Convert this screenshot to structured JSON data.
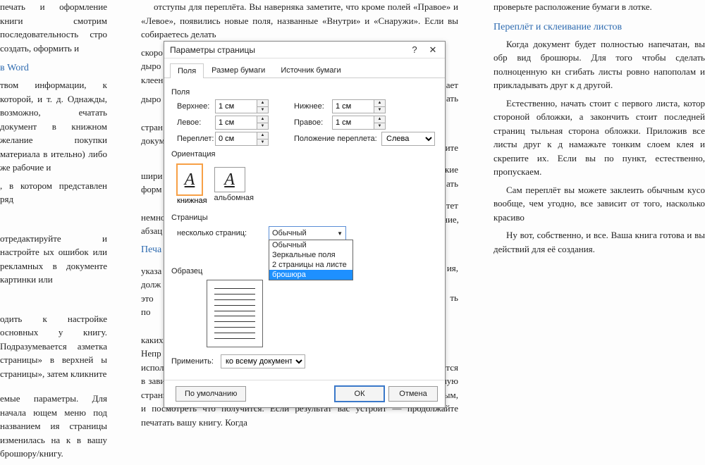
{
  "doc": {
    "left": {
      "p1": "печать и оформление книги смотрим последовательность стро создать, оформить и",
      "h1": "в Word",
      "p2": "твом информации, к которой, и т. д. Однажды, возможно, ечатать документ в книжном желание покупки материала в ительно) либо же рабочие и",
      "p3": ", в котором представлен ряд",
      "p4": "отредактируйте и настройте ых ошибок или рекламных в документе картинки или",
      "p5": "одить к настройке основных у книгу. Подразумевается азметка страницы» в верхней ы страницы», затем кликните",
      "p6": "емые параметры. Для начала ющем меню под названием ия страницы изменилась на к в вашу брошюру/книгу."
    },
    "mid": {
      "p1": "отступы для переплёта. Вы наверняка заметите, что кроме полей «Правое» и «Левое», появились новые поля, названные «Внутри» и «Снаружи». Если вы собираетесь делать",
      "p2": "скоро",
      "p3": "дыро",
      "p4": "клеен",
      "p5": "дыро",
      "p6": "стран",
      "p7": "докум",
      "p8": "шири",
      "p9": "форм",
      "p10": "немно",
      "p11": "абзац",
      "h1": "Печа",
      "p12": "указа",
      "p13": "долж",
      "p14": "это по",
      "p15": "каких",
      "p16": "Непр",
      "p17": "использованной стороне листа, что будет крайне обидно. Этот момент разнится в зависимости от принтера, поэтому рекомендую вам напечатать одну пробную страницу, переложить её для последующей печати так, как вы считаете нужным, и посмотреть что получится. Если результат вас устроит — продолжайте печатать вашу книгу. Когда",
      "frag1": "ает",
      "frag2": "ать",
      "frag3": "ите",
      "frag4": "кие",
      "frag5": "ать",
      "frag6": "тет",
      "frag7": "ние,",
      "frag8": "ия,",
      "frag9": "ть"
    },
    "right": {
      "p1": "проверьте расположение бумаги в лотке.",
      "h1": "Переплёт и склеивание листов",
      "p2": "Когда документ будет полностью напечатан, вы обр вид брошюры. Для того чтобы сделать полноценную кн сгибать листы ровно напополам и прикладывать друг к д другой.",
      "p3": "Естественно, начать стоит с первого листа, котор стороной обложки, а закончить стоит последней страниц тыльная сторона обложки. Приложив все листы друг к д намажьте тонким слоем клея и скрепите их. Если вы по пункт, естественно, пропускаем.",
      "p4": "Сам переплёт вы можете заклеить обычным кусо вообще, чем угодно, все зависит от того, насколько красиво",
      "p5": "Ну вот, собственно, и все. Ваша книга готова и вы действий для её создания."
    }
  },
  "dialog": {
    "title": "Параметры страницы",
    "tabs": {
      "fields": "Поля",
      "paper": "Размер бумаги",
      "source": "Источник бумаги"
    },
    "groups": {
      "fields": "Поля",
      "orient": "Ориентация",
      "pages": "Страницы",
      "sample": "Образец"
    },
    "labels": {
      "top": "Верхнее:",
      "bottom": "Нижнее:",
      "left": "Левое:",
      "right": "Правое:",
      "gutter": "Переплет:",
      "gutterpos": "Положение переплета:",
      "portrait": "книжная",
      "landscape": "альбомная",
      "multipage": "несколько страниц:",
      "apply": "Применить:"
    },
    "values": {
      "top": "1 см",
      "bottom": "1 см",
      "left": "1 см",
      "right": "1 см",
      "gutter": "0 см",
      "gutterpos": "Слева",
      "multipage": "Обычный",
      "apply": "ко всему документу"
    },
    "dropdown": {
      "o1": "Обычный",
      "o2": "Зеркальные поля",
      "o3": "2 страницы на листе",
      "o4": "брошюра"
    },
    "glyph": "А",
    "buttons": {
      "default": "По умолчанию",
      "ok": "ОК",
      "cancel": "Отмена"
    }
  }
}
